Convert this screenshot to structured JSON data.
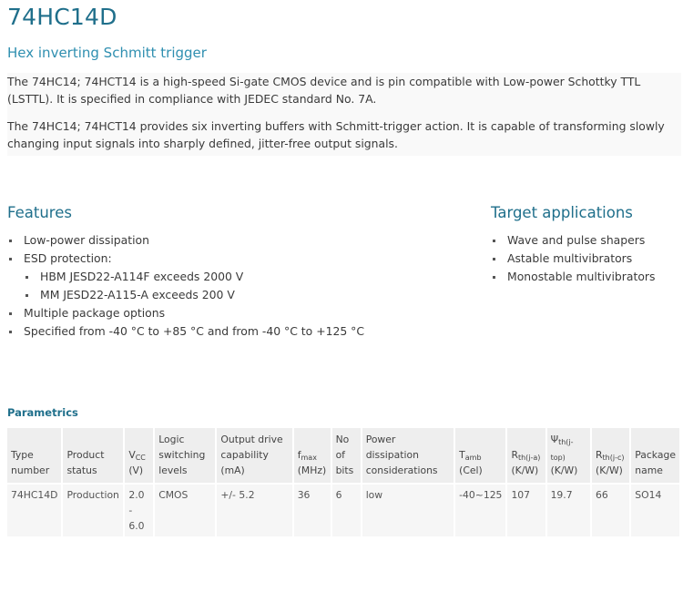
{
  "header": {
    "title": "74HC14D",
    "subtitle": "Hex inverting Schmitt trigger"
  },
  "description": [
    "The 74HC14; 74HCT14 is a high-speed Si-gate CMOS device and is pin compatible with Low-power Schottky TTL (LSTTL). It is specified in compliance with JEDEC standard No. 7A.",
    "The 74HC14; 74HCT14 provides six inverting buffers with Schmitt-trigger action. It is capable of transforming slowly changing input signals into sharply defined, jitter-free output signals."
  ],
  "features": {
    "heading": "Features",
    "items": [
      "Low-power dissipation",
      "ESD protection:",
      "HBM JESD22-A114F exceeds 2000 V",
      "MM JESD22-A115-A exceeds 200 V",
      "Multiple package options",
      "Specified from -40 °C to +85 °C and from -40 °C to +125 °C"
    ]
  },
  "applications": {
    "heading": "Target applications",
    "items": [
      "Wave and pulse shapers",
      "Astable multivibrators",
      "Monostable multivibrators"
    ]
  },
  "parametrics": {
    "heading": "Parametrics",
    "columns": {
      "type_number": "Type number",
      "product_status": "Product status",
      "vcc_main": "V",
      "vcc_sub": "CC",
      "vcc_unit": "(V)",
      "logic_levels": "Logic switching levels",
      "output_drive": "Output drive capability (mA)",
      "fmax_main": "f",
      "fmax_sub": "max",
      "fmax_unit": "(MHz)",
      "no_of_bits": "No of bits",
      "power_dissipation": "Power dissipation considerations",
      "tamb_main": "T",
      "tamb_sub": "amb",
      "tamb_unit": "(Cel)",
      "rthja_main": "R",
      "rthja_sub": "th(j-a)",
      "rthja_unit": "(K/W)",
      "psi_main": "Ψ",
      "psi_sub": "th(j-top)",
      "psi_unit": "(K/W)",
      "rthjc_main": "R",
      "rthjc_sub": "th(j-c)",
      "rthjc_unit": "(K/W)",
      "package_name": "Package name"
    },
    "row": {
      "type_number": "74HC14D",
      "product_status": "Production",
      "vcc": "2.0 - 6.0",
      "logic_levels": "CMOS",
      "output_drive": "+/- 5.2",
      "fmax": "36",
      "no_of_bits": "6",
      "power_dissipation": "low",
      "tamb": "-40~125",
      "rthja": "107",
      "psi": "19.7",
      "rthjc": "66",
      "package_name": "SO14"
    }
  }
}
